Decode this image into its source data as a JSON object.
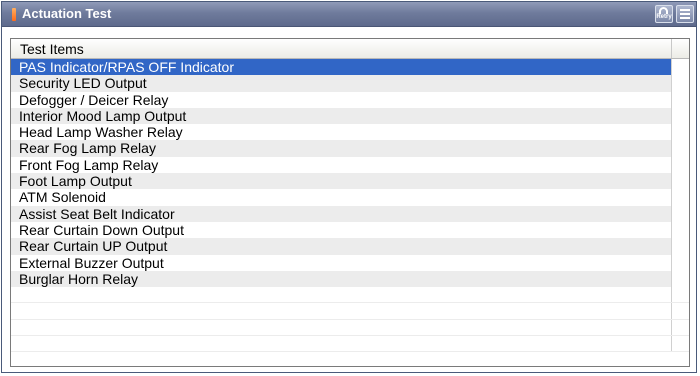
{
  "window": {
    "title": "Actuation Test"
  },
  "toolbar": {
    "retry_label": "Retry",
    "retry_icon": "retry-icon",
    "menu_icon": "menu-icon"
  },
  "table": {
    "header": "Test Items",
    "selected_index": 0,
    "selected_color": "#3166c6",
    "items": [
      "PAS Indicator/RPAS OFF Indicator",
      "Security LED Output",
      "Defogger / Deicer Relay",
      "Interior Mood Lamp Output",
      "Head Lamp Washer Relay",
      "Rear Fog Lamp Relay",
      "Front Fog Lamp Relay",
      "Foot Lamp Output",
      "ATM Solenoid",
      "Assist Seat Belt Indicator",
      "Rear Curtain Down Output",
      "Rear Curtain UP Output",
      "External Buzzer Output",
      "Burglar Horn Relay"
    ]
  },
  "colors": {
    "titlebar": "#6f7b9c",
    "accent": "#ff6a1a",
    "row_alt": "#ececec"
  }
}
